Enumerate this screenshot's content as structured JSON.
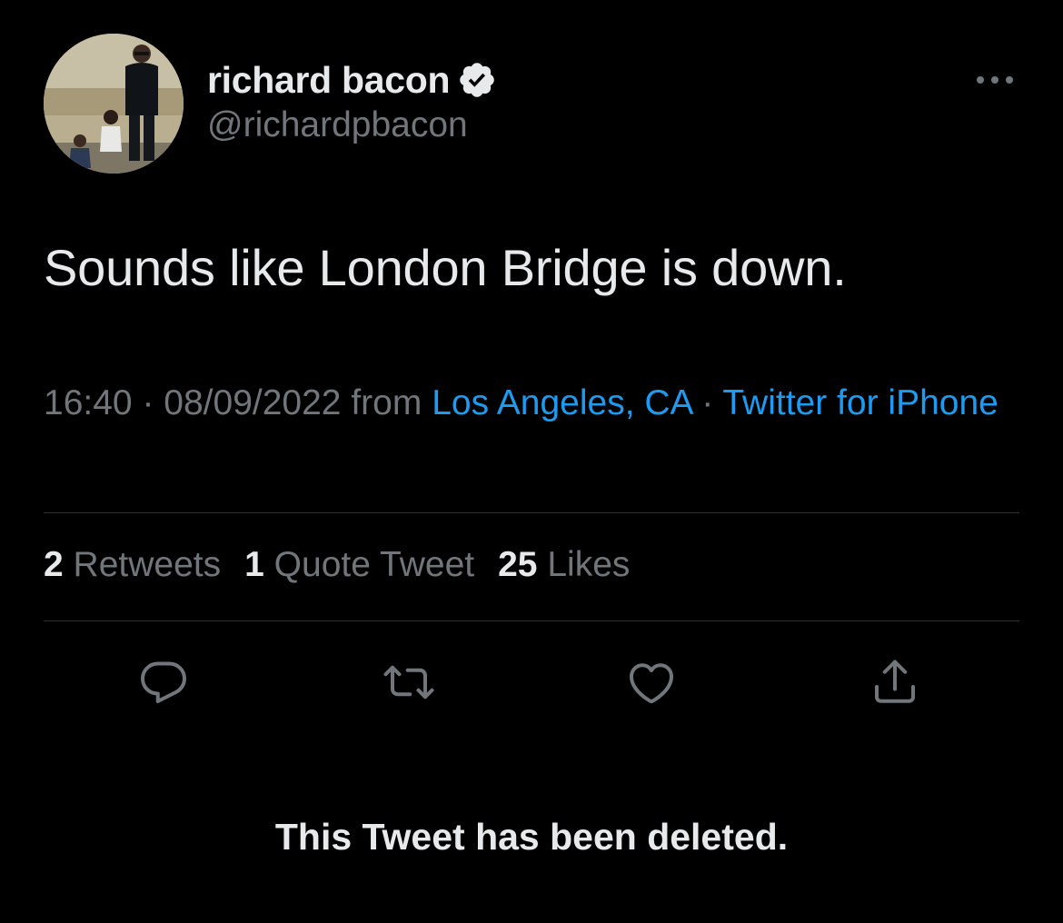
{
  "author": {
    "name": "richard bacon",
    "handle": "@richardpbacon",
    "verified": true,
    "avatar_icon": "profile-photo"
  },
  "tweet": {
    "text": "Sounds like London Bridge is down.",
    "time": "16:40",
    "date": "08/09/2022",
    "from_word": "from",
    "location": "Los Angeles, CA",
    "source": "Twitter for iPhone",
    "separator": "·"
  },
  "stats": {
    "retweets_count": "2",
    "retweets_label": "Retweets",
    "quotes_count": "1",
    "quotes_label": "Quote Tweet",
    "likes_count": "25",
    "likes_label": "Likes"
  },
  "actions": {
    "reply_icon": "reply-icon",
    "retweet_icon": "retweet-icon",
    "like_icon": "heart-icon",
    "share_icon": "share-icon"
  },
  "notice": "This Tweet has been deleted.",
  "colors": {
    "background": "#000000",
    "text": "#e7e9ea",
    "secondary": "#71767b",
    "link": "#1d9bf0",
    "divider": "#2f3336"
  }
}
